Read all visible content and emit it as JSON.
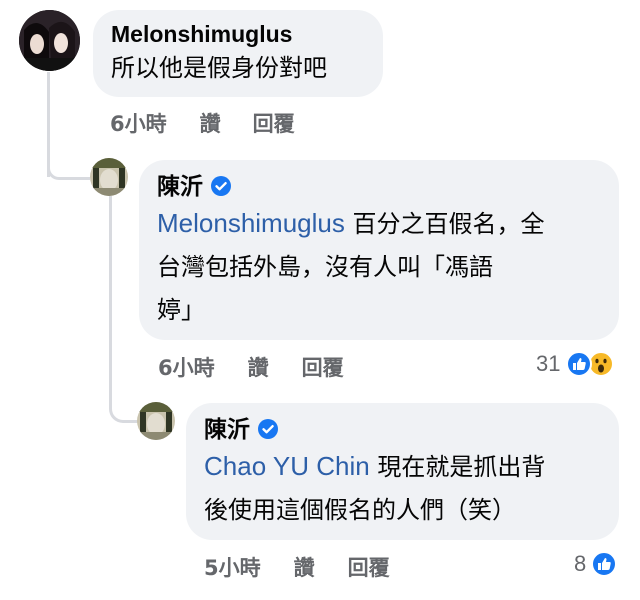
{
  "comments": [
    {
      "author": "Melonshimuglus",
      "text": "所以他是假身份對吧",
      "time": "6小時",
      "like_label": "讚",
      "reply_label": "回覆"
    },
    {
      "author": "陳沂",
      "verified": true,
      "mention": "Melonshimuglus",
      "text_line1": "百分之百假名，全",
      "text_line2": "台灣包括外島，沒有人叫「馮語",
      "text_line3": "婷」",
      "time": "6小時",
      "like_label": "讚",
      "reply_label": "回覆",
      "reaction_count": "31",
      "reactions": [
        "like-icon",
        "wow-icon"
      ]
    },
    {
      "author": "陳沂",
      "verified": true,
      "mention": "Chao YU Chin",
      "text_line1": "現在就是抓出背",
      "text_line2": "後使用這個假名的人們（笑）",
      "time": "5小時",
      "like_label": "讚",
      "reply_label": "回覆",
      "reaction_count": "8",
      "reactions": [
        "like-icon"
      ]
    }
  ],
  "colors": {
    "bubble": "#f0f2f5",
    "meta_text": "#65676b",
    "mention": "#2d5fa8",
    "verified": "#1877f2",
    "like": "#1877f2",
    "wow": "#f7b928"
  }
}
